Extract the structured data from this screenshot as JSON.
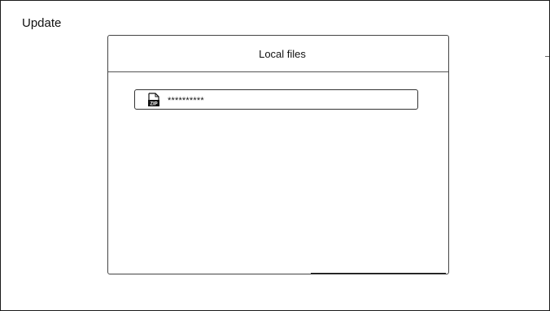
{
  "screen": {
    "title": "Update"
  },
  "dialog": {
    "title": "Local files",
    "files": [
      {
        "name": "**********",
        "icon": "zip-file-icon",
        "icon_text": "ZIP"
      }
    ]
  }
}
